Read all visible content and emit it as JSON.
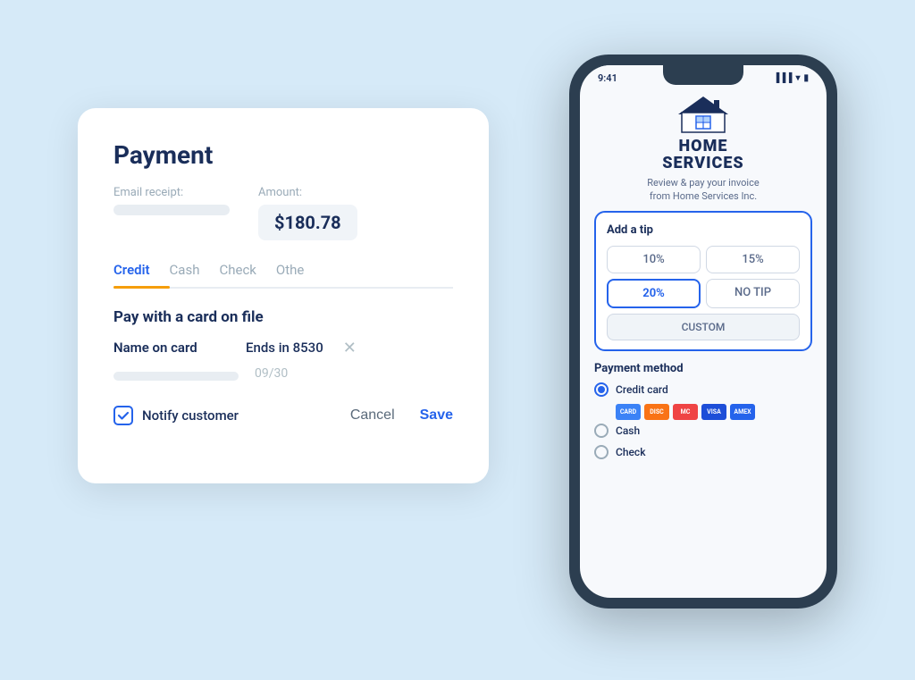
{
  "payment_card": {
    "title": "Payment",
    "email_label": "Email receipt:",
    "amount_label": "Amount:",
    "amount_value": "$180.78",
    "tabs": [
      {
        "label": "Credit",
        "active": true
      },
      {
        "label": "Cash",
        "active": false
      },
      {
        "label": "Check",
        "active": false
      },
      {
        "label": "Othe",
        "active": false
      }
    ],
    "pay_section_title": "Pay with a card on file",
    "card_name_label": "Name on card",
    "card_ends_label": "Ends in 8530",
    "expiry_value": "09/30",
    "notify_label": "Notify customer",
    "cancel_label": "Cancel",
    "save_label": "Save"
  },
  "phone": {
    "status_time": "9:41",
    "brand_name": "HOME\nSERVICES",
    "brand_tagline": "Review & pay your invoice\nfrom Home Services Inc.",
    "tip_section_title": "Add a tip",
    "tip_options": [
      {
        "label": "10%",
        "active": false
      },
      {
        "label": "15%",
        "active": false
      },
      {
        "label": "20%",
        "active": true
      },
      {
        "label": "NO TIP",
        "active": false
      },
      {
        "label": "CUSTOM",
        "active": false,
        "custom": true
      }
    ],
    "payment_method_title": "Payment method",
    "payment_options": [
      {
        "label": "Credit card",
        "selected": true
      },
      {
        "label": "Cash",
        "selected": false
      },
      {
        "label": "Check",
        "selected": false
      }
    ]
  }
}
